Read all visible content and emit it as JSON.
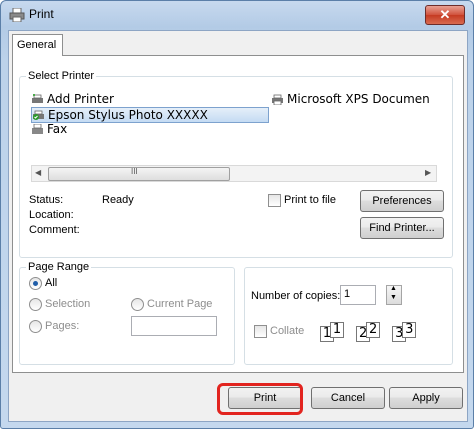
{
  "window": {
    "title": "Print",
    "close_symbol": "✕"
  },
  "tabs": [
    {
      "label": "General"
    }
  ],
  "select_printer": {
    "label": "Select Printer",
    "printers": [
      {
        "name": "Add Printer",
        "icon": "add-printer-icon"
      },
      {
        "name": "Microsoft XPS Documen",
        "icon": "printer-icon"
      },
      {
        "name": "Epson Stylus Photo XXXXX",
        "icon": "printer-check-icon",
        "selected": true
      },
      {
        "name": "Fax",
        "icon": "fax-icon"
      }
    ],
    "scroll_thumb_grip": "III",
    "status_label": "Status:",
    "status_value": "Ready",
    "location_label": "Location:",
    "comment_label": "Comment:",
    "print_to_file_label": "Print to file",
    "preferences_button": "Preferences",
    "find_printer_button": "Find Printer..."
  },
  "page_range": {
    "label": "Page Range",
    "all": "All",
    "selection": "Selection",
    "current_page": "Current Page",
    "pages": "Pages:",
    "selected_option": "All"
  },
  "copies": {
    "number_label": "Number of copies:",
    "value": "1",
    "collate_label": "Collate",
    "collate_pages": [
      "1",
      "1",
      "2",
      "2",
      "3",
      "3"
    ]
  },
  "footer": {
    "print_button": "Print",
    "cancel_button": "Cancel",
    "apply_button": "Apply"
  },
  "colors": {
    "highlight": "#e2241f",
    "selection": "#c4dbf3",
    "close": "#c53a22"
  }
}
